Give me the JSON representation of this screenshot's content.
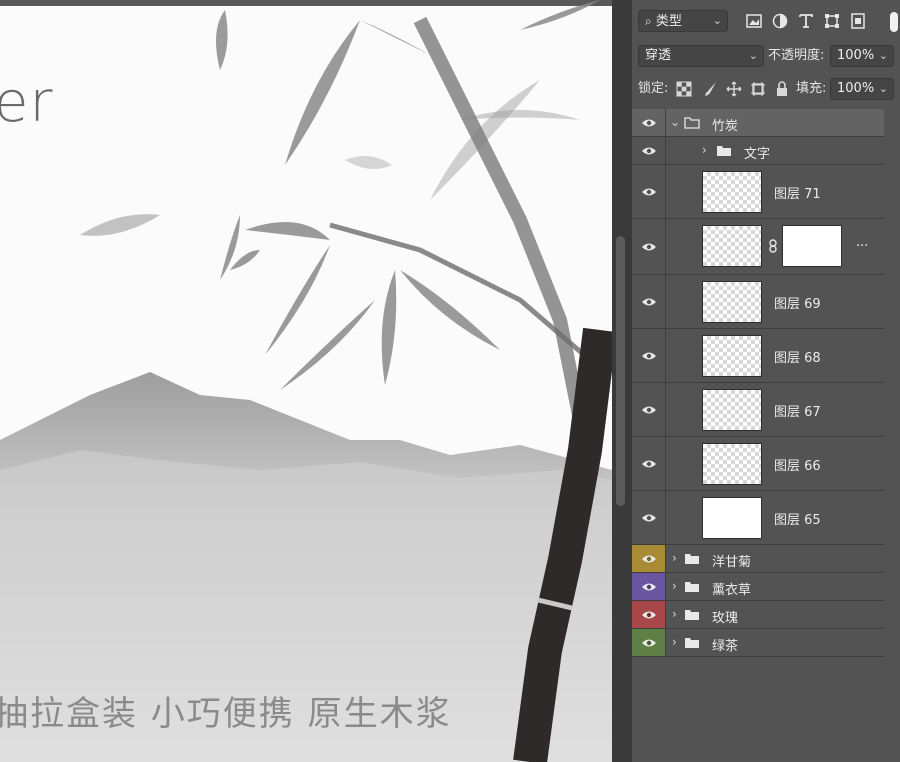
{
  "canvas": {
    "big_text": "er",
    "slogan": "抽拉盒装  小巧便携  原生木浆"
  },
  "panel": {
    "filter_kind": "类型",
    "blend_mode": "穿透",
    "opacity_label": "不透明度:",
    "opacity_value": "100%",
    "lock_label": "锁定:",
    "fill_label": "填充:",
    "fill_value": "100%"
  },
  "layers": {
    "group_main": "竹炭",
    "sub_group": "文字",
    "l71": "图层 71",
    "masked_more": "...",
    "l69": "图层 69",
    "l68": "图层 68",
    "l67": "图层 67",
    "l66": "图层 66",
    "l65": "图层 65",
    "g1": "洋甘菊",
    "g2": "薰衣草",
    "g3": "玫瑰",
    "g4": "绿茶"
  },
  "colors": {
    "eye_g1": "#a88c35",
    "eye_g2": "#6a55a0",
    "eye_g3": "#a84747",
    "eye_g4": "#5f8044"
  }
}
